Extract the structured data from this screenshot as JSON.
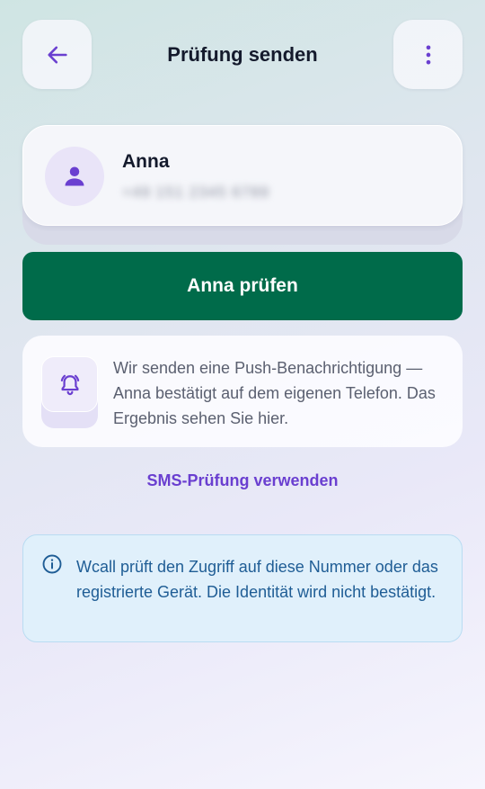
{
  "header": {
    "title": "Prüfung senden",
    "back_icon": "arrow-left-icon",
    "more_icon": "more-vertical-icon"
  },
  "contact": {
    "name": "Anna",
    "number": "+49 151 2345 6789",
    "avatar_icon": "person-icon"
  },
  "primary_action": {
    "label": "Anna prüfen"
  },
  "push_info": {
    "icon": "bell-ringing-icon",
    "text": "Wir senden eine Push-Benachrichtigung — Anna bestätigt auf dem eigenen Telefon. Das Ergebnis sehen Sie hier."
  },
  "sms_link": {
    "label": "SMS-Prüfung verwenden"
  },
  "notice": {
    "icon": "info-icon",
    "text": "Wcall prüft den Zugriff auf diese Nummer oder das registrierte Gerät. Die Identität wird nicht bestätigt."
  },
  "colors": {
    "accent": "#6a3fd0",
    "primary": "#006b4a",
    "notice_text": "#1f5d95",
    "notice_bg": "#e0f0fb"
  }
}
